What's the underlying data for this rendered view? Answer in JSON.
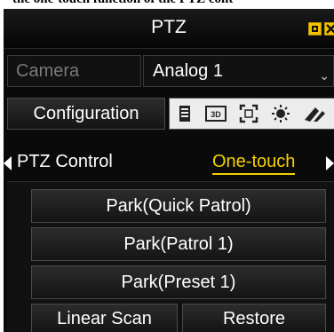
{
  "caption": "the one-touch function of the PTZ cont",
  "window": {
    "title": "PTZ",
    "minimize_icon": "minimize-icon",
    "close_icon": "close-icon"
  },
  "camera": {
    "label": "Camera",
    "value": "Analog 1",
    "arrow_icon": "chevron-down-icon"
  },
  "configuration": {
    "button_label": "Configuration",
    "tools": [
      "menu-list-icon",
      "3d-icon",
      "focus-frame-icon",
      "light-icon",
      "wiper-icon"
    ]
  },
  "tabs": {
    "left_arrow": "left-arrow-icon",
    "items": [
      "PTZ Control",
      "One-touch"
    ],
    "active": "One-touch",
    "right_arrow": "right-arrow-icon",
    "active_color": "#f5d000"
  },
  "actions": {
    "park_quick_patrol": "Park(Quick Patrol)",
    "park_patrol_1": "Park(Patrol 1)",
    "park_preset_1": "Park(Preset 1)",
    "linear_scan": "Linear Scan",
    "restore": "Restore"
  }
}
